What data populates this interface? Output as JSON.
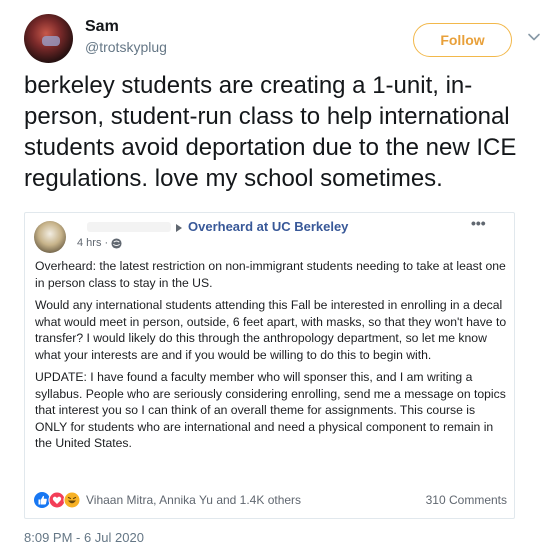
{
  "author": {
    "display_name": "Sam",
    "handle": "@trotskyplug"
  },
  "follow_label": "Follow",
  "tweet_text": "berkeley students are creating a 1-unit, in-person, student-run class to help international students avoid deportation due to the new ICE regulations. love my school sometimes.",
  "embedded_post": {
    "group_name": "Overheard at UC Berkeley",
    "time": "4 hrs ·",
    "more": "•••",
    "paragraphs": [
      "Overheard: the latest restriction on non-immigrant students needing to take at least one in person class to stay in the US.",
      "Would any international students attending this Fall be interested in enrolling in a decal what would meet in person, outside, 6 feet apart, with masks, so that they won't have to transfer? I would likely do this through the anthropology department, so let me know what your interests are and if you would be willing to do this to begin with.",
      "UPDATE: I have found a faculty member who will sponser this, and I am writing a syllabus. People who are seriously considering enrolling, send me a message on topics that interest you so I can think of an overall theme for assignments. This course is ONLY for students who are international and need a physical component to remain in the United States."
    ],
    "reactors": "Vihaan Mitra, Annika Yu and 1.4K others",
    "comments": "310 Comments",
    "reaction_icons": [
      "like-icon",
      "love-icon",
      "haha-icon"
    ]
  },
  "timestamp": "8:09 PM - 6 Jul 2020",
  "colors": {
    "follow_accent": "#e8a03a",
    "group_link": "#385898",
    "like_blue": "#1877f2",
    "love_red": "#f33e58"
  }
}
